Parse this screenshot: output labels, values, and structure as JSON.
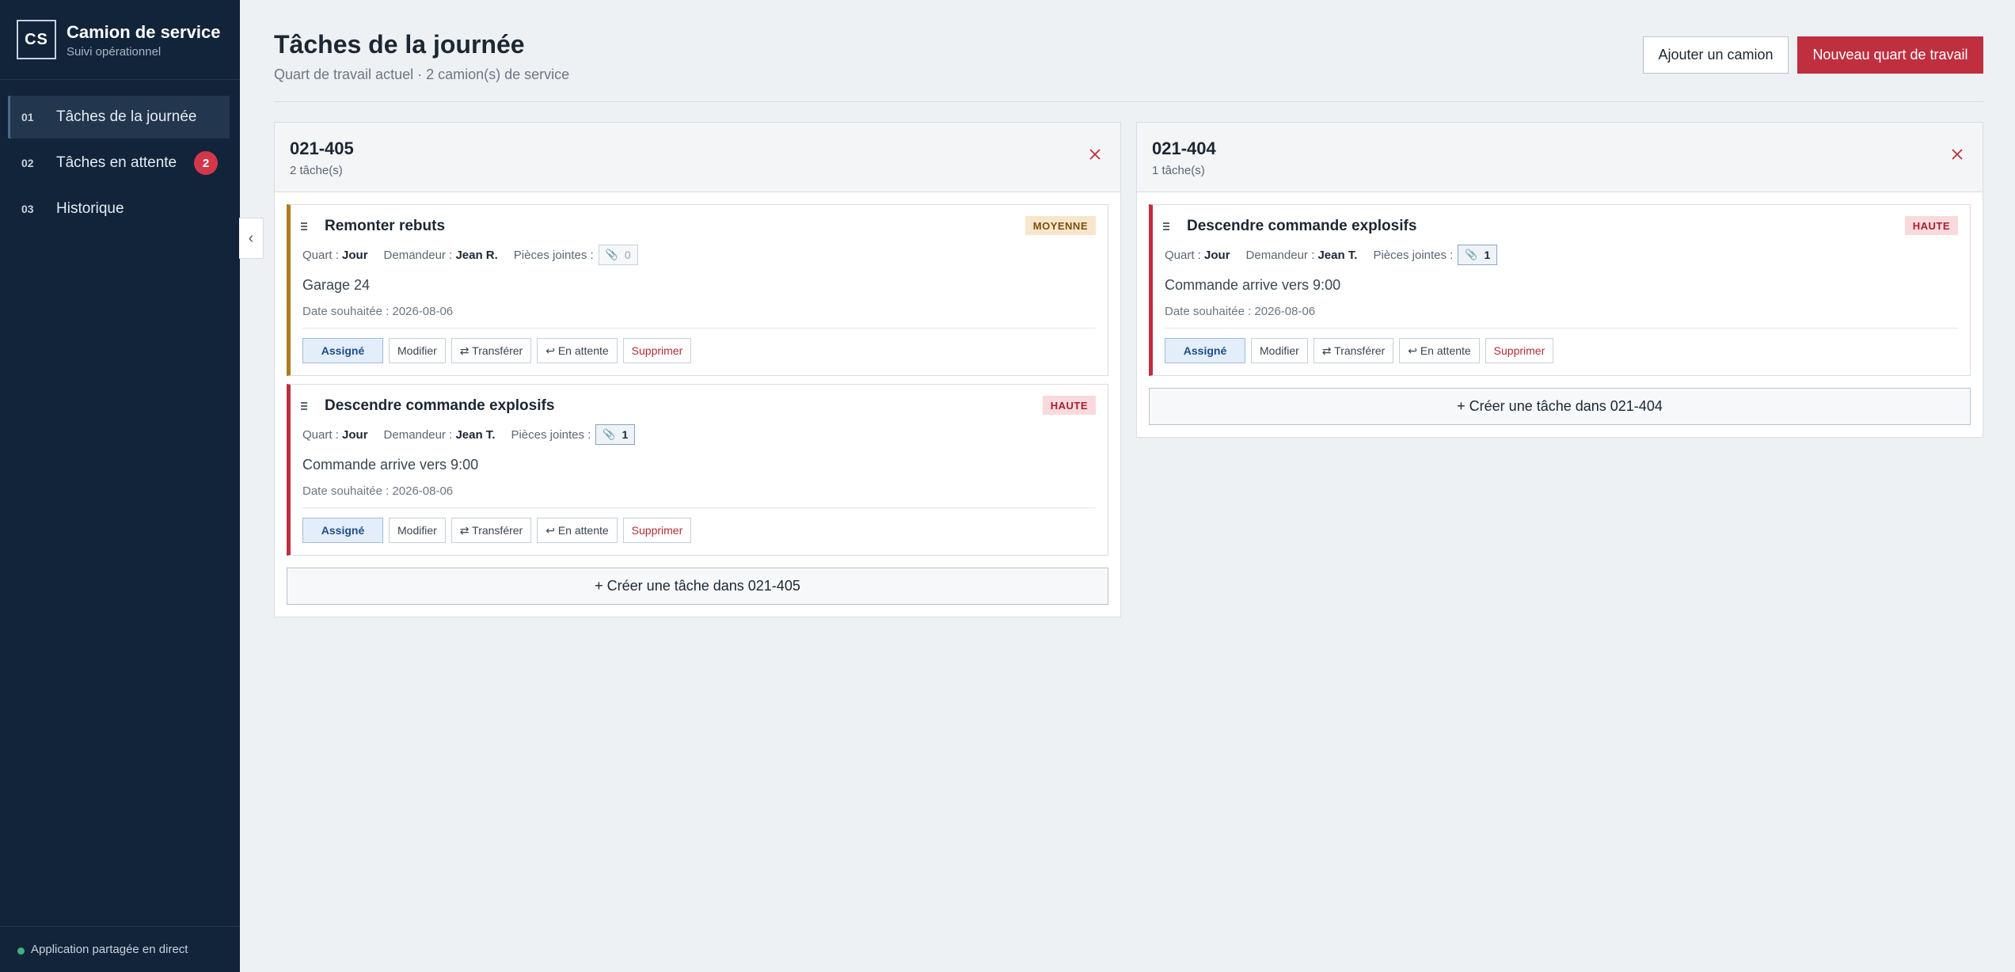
{
  "app": {
    "logo_initials": "CS",
    "title": "Camion de service",
    "subtitle": "Suivi opérationnel"
  },
  "nav": [
    {
      "num": "01",
      "label": "Tâches de la journée",
      "active": true
    },
    {
      "num": "02",
      "label": "Tâches en attente",
      "badge": "2"
    },
    {
      "num": "03",
      "label": "Historique"
    }
  ],
  "footer": {
    "status": "Application partagée en direct",
    "status_color": "#3fb27f"
  },
  "header": {
    "title": "Tâches de la journée",
    "subtitle": "Quart de travail actuel · 2 camion(s) de service",
    "add_truck_label": "Ajouter un camion",
    "new_shift_label": "Nouveau quart de travail"
  },
  "labels": {
    "quart": "Quart :",
    "demandeur": "Demandeur :",
    "pieces": "Pièces jointes :",
    "date_prefix": "Date souhaitée :"
  },
  "columns": [
    {
      "id": "021-405",
      "count": "2 tâche(s)",
      "create_label": "+ Créer une tâche dans 021-405",
      "tasks": [
        {
          "title": "Remonter rebuts",
          "priority": "MOYENNE",
          "quart": "Jour",
          "demandeur": "Jean R.",
          "attachments": "0",
          "description": "Garage 24",
          "date": "2026-08-06",
          "actions": {
            "assigned": "Assigné",
            "edit": "Modifier",
            "transfer": "⇄ Transférer",
            "pending": "↩ En attente",
            "delete": "Supprimer"
          }
        },
        {
          "title": "Descendre commande explosifs",
          "priority": "HAUTE",
          "quart": "Jour",
          "demandeur": "Jean T.",
          "attachments": "1",
          "description": "Commande arrive vers 9:00",
          "date": "2026-08-06",
          "actions": {
            "assigned": "Assigné",
            "edit": "Modifier",
            "transfer": "⇄ Transférer",
            "pending": "↩ En attente",
            "delete": "Supprimer"
          }
        }
      ]
    },
    {
      "id": "021-404",
      "count": "1 tâche(s)",
      "create_label": "+ Créer une tâche dans 021-404",
      "tasks": [
        {
          "title": "Descendre commande explosifs",
          "priority": "HAUTE",
          "quart": "Jour",
          "demandeur": "Jean T.",
          "attachments": "1",
          "description": "Commande arrive vers 9:00",
          "date": "2026-08-06",
          "actions": {
            "assigned": "Assigné",
            "edit": "Modifier",
            "transfer": "⇄ Transférer",
            "pending": "↩ En attente",
            "delete": "Supprimer"
          }
        }
      ]
    }
  ],
  "colors": {
    "sidebar": "#12243a",
    "accent_red": "#bf2f3f",
    "priority_medium": "#b07a1d",
    "priority_high": "#bf2f3f"
  }
}
